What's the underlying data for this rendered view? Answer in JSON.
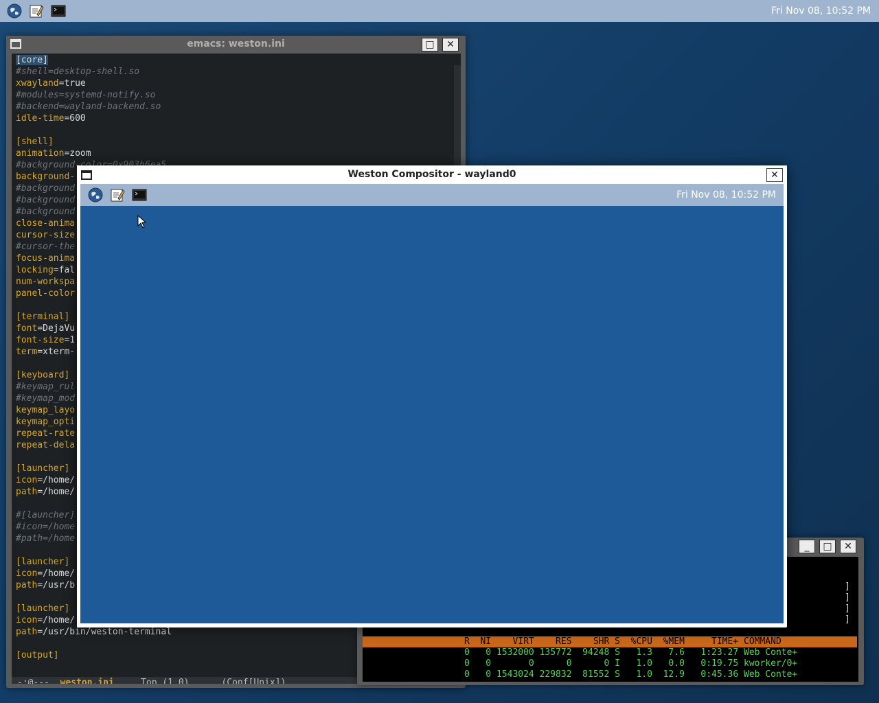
{
  "panel": {
    "clock": "Fri Nov 08, 10:52 PM",
    "launchers": [
      "web-browser-icon",
      "text-editor-icon",
      "terminal-icon"
    ]
  },
  "emacs": {
    "title": "emacs: weston.ini",
    "lines": [
      {
        "kind": "section",
        "text": "[core]",
        "cursor": true
      },
      {
        "kind": "comment",
        "text": "#shell=desktop-shell.so"
      },
      {
        "kind": "kv",
        "key": "xwayland",
        "value": "=true"
      },
      {
        "kind": "comment",
        "text": "#modules=systemd-notify.so"
      },
      {
        "kind": "comment",
        "text": "#backend=wayland-backend.so"
      },
      {
        "kind": "kv",
        "key": "idle-time",
        "value": "=600"
      },
      {
        "kind": "blank",
        "text": ""
      },
      {
        "kind": "section",
        "text": "[shell]"
      },
      {
        "kind": "kv",
        "key": "animation",
        "value": "=zoom"
      },
      {
        "kind": "comment",
        "text": "#background-color=0x903b6ea5"
      },
      {
        "kind": "kv",
        "key": "background-",
        "value": ""
      },
      {
        "kind": "comment",
        "text": "#background"
      },
      {
        "kind": "comment",
        "text": "#background"
      },
      {
        "kind": "comment",
        "text": "#background"
      },
      {
        "kind": "kv",
        "key": "close-anima",
        "value": ""
      },
      {
        "kind": "kv",
        "key": "cursor-size",
        "value": ""
      },
      {
        "kind": "comment",
        "text": "#cursor-the"
      },
      {
        "kind": "kv",
        "key": "focus-anima",
        "value": ""
      },
      {
        "kind": "kv",
        "key": "locking",
        "value": "=fal"
      },
      {
        "kind": "kv",
        "key": "num-workspa",
        "value": ""
      },
      {
        "kind": "kv",
        "key": "panel-color",
        "value": ""
      },
      {
        "kind": "blank",
        "text": ""
      },
      {
        "kind": "section",
        "text": "[terminal]"
      },
      {
        "kind": "kv",
        "key": "font",
        "value": "=DejaVu"
      },
      {
        "kind": "kv",
        "key": "font-size",
        "value": "=1"
      },
      {
        "kind": "kv",
        "key": "term",
        "value": "=xterm-"
      },
      {
        "kind": "blank",
        "text": ""
      },
      {
        "kind": "section",
        "text": "[keyboard]"
      },
      {
        "kind": "comment",
        "text": "#keymap_rul"
      },
      {
        "kind": "comment",
        "text": "#keymap_mod"
      },
      {
        "kind": "kv",
        "key": "keymap_layo",
        "value": ""
      },
      {
        "kind": "kv",
        "key": "keymap_opti",
        "value": ""
      },
      {
        "kind": "kv",
        "key": "repeat-rate",
        "value": ""
      },
      {
        "kind": "kv",
        "key": "repeat-dela",
        "value": ""
      },
      {
        "kind": "blank",
        "text": ""
      },
      {
        "kind": "section",
        "text": "[launcher]"
      },
      {
        "kind": "kv",
        "key": "icon",
        "value": "=/home/"
      },
      {
        "kind": "kv",
        "key": "path",
        "value": "=/home/"
      },
      {
        "kind": "blank",
        "text": ""
      },
      {
        "kind": "comment",
        "text": "#[launcher]"
      },
      {
        "kind": "comment",
        "text": "#icon=/home"
      },
      {
        "kind": "comment",
        "text": "#path=/home"
      },
      {
        "kind": "blank",
        "text": ""
      },
      {
        "kind": "section",
        "text": "[launcher]"
      },
      {
        "kind": "kv",
        "key": "icon",
        "value": "=/home/"
      },
      {
        "kind": "kv",
        "key": "path",
        "value": "=/usr/b"
      },
      {
        "kind": "blank",
        "text": ""
      },
      {
        "kind": "section",
        "text": "[launcher]"
      },
      {
        "kind": "kv",
        "key": "icon",
        "value": "=/home/"
      },
      {
        "kind": "kv",
        "key": "path",
        "value": "=/usr/bin/weston-terminal"
      },
      {
        "kind": "blank",
        "text": ""
      },
      {
        "kind": "section",
        "text": "[output]"
      }
    ],
    "modeline": {
      "status": "-:@---  ",
      "buffer": "weston.ini",
      "position": "     Top (1,0)      (Conf[Unix])"
    }
  },
  "terminal": {
    "brackets": [
      "]",
      "]",
      "]",
      "]"
    ],
    "header": "R  NI    VIRT    RES    SHR S  %CPU  %MEM     TIME+ COMMAND",
    "rows": [
      "0   0 1532000 135772  94248 S   1.3   7.6   1:23.27 Web Conte+",
      "0   0       0      0      0 I   1.0   0.0   0:19.75 kworker/0+",
      "0   0 1543024 229832  81552 S   1.0  12.9   0:45.36 Web Conte+"
    ]
  },
  "weston": {
    "title": "Weston Compositor - wayland0",
    "close": "✕",
    "clock": "Fri Nov 08, 10:52 PM"
  },
  "glyphs": {
    "maximize": "□",
    "minimize": "_",
    "close": "✕"
  }
}
